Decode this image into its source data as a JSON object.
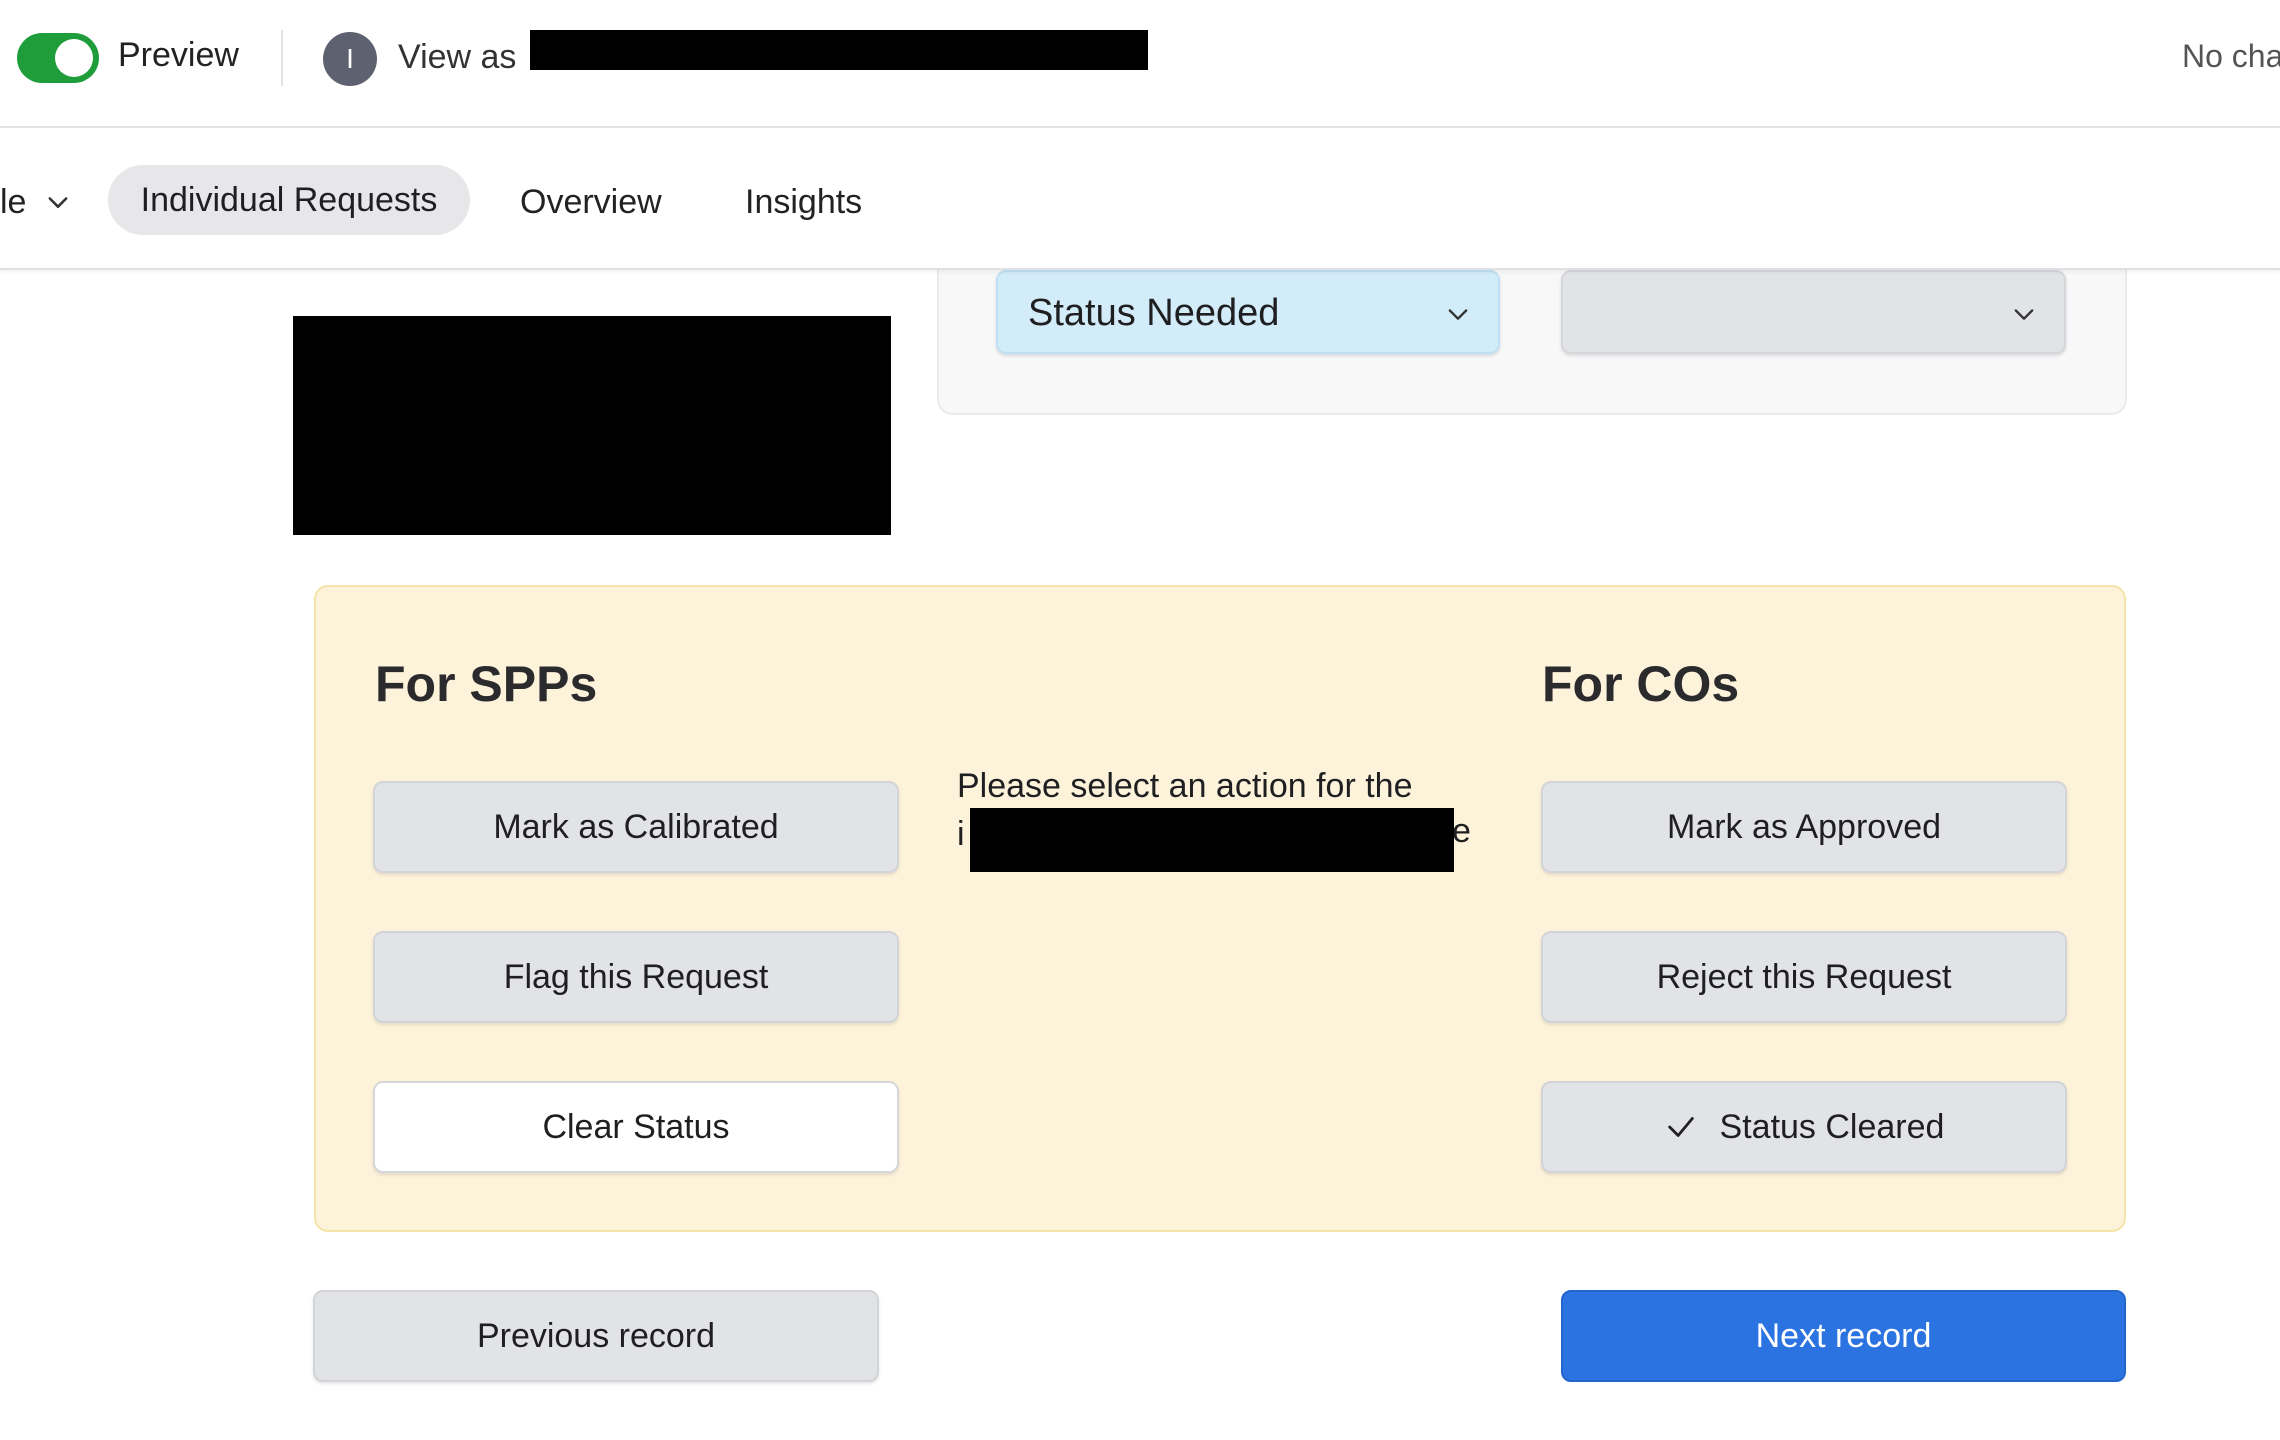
{
  "topbar": {
    "preview_label": "Preview",
    "preview_on": true,
    "avatar_initial": "I",
    "view_as_label": "View as",
    "status_text": "No cha"
  },
  "nav": {
    "crop_label": "le",
    "tabs": [
      {
        "label": "Individual Requests",
        "active": true
      },
      {
        "label": "Overview",
        "active": false
      },
      {
        "label": "Insights",
        "active": false
      }
    ]
  },
  "filters": {
    "status_value": "Status Needed",
    "second_value": ""
  },
  "panel": {
    "left_title": "For SPPs",
    "right_title": "For COs",
    "left_buttons": [
      {
        "label": "Mark as Calibrated"
      },
      {
        "label": "Flag this Request"
      },
      {
        "label": "Clear Status"
      }
    ],
    "right_buttons": [
      {
        "label": "Mark as Approved"
      },
      {
        "label": "Reject this Request"
      },
      {
        "label": "Status Cleared",
        "icon": "check-icon"
      }
    ],
    "message_line1": "Please select an action for the",
    "message_line2_start": "i",
    "message_line2_end": "e"
  },
  "footer": {
    "previous_label": "Previous record",
    "next_label": "Next record"
  },
  "colors": {
    "toggle_on": "#1f9d3a",
    "panel_bg": "#fdf3db",
    "primary": "#2a73e0",
    "status_dropdown": "#d3ecfa"
  }
}
